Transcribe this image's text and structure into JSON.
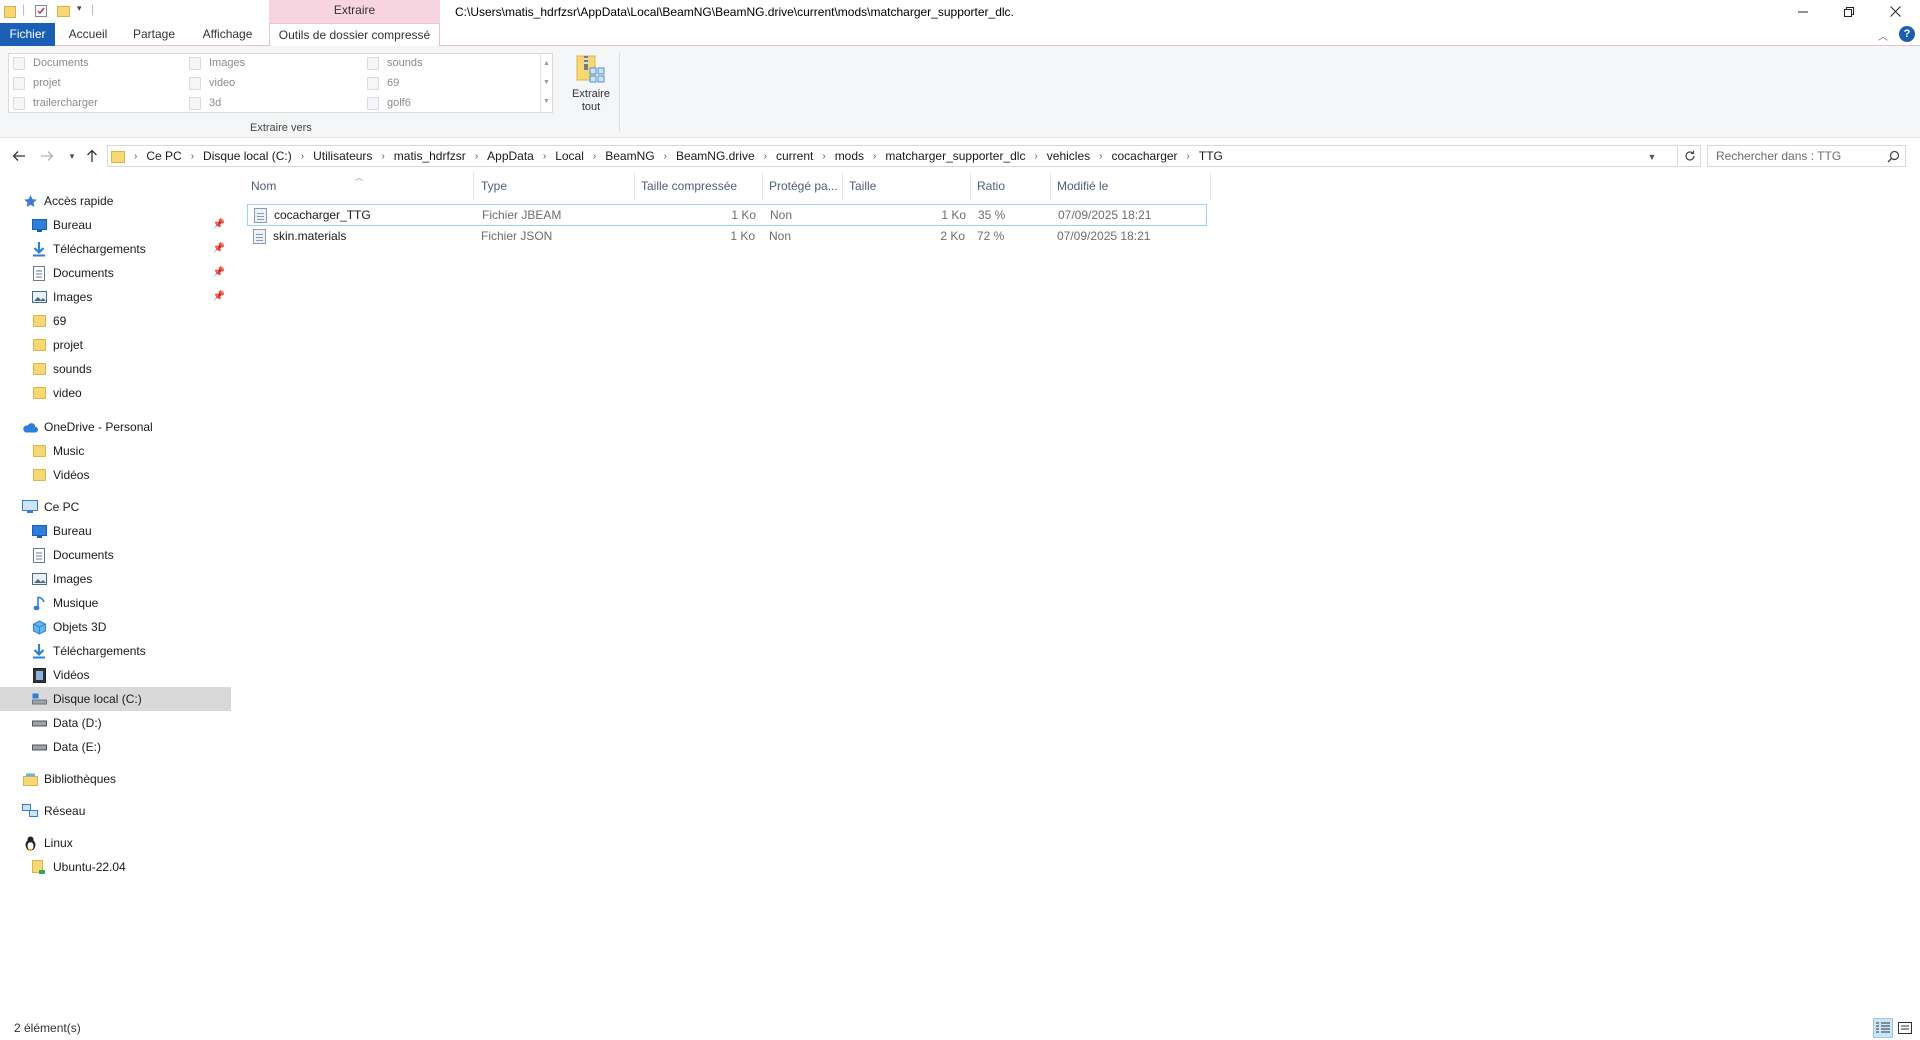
{
  "window": {
    "title": "C:\\Users\\matis_hdrfzsr\\AppData\\Local\\BeamNG\\BeamNG.drive\\current\\mods\\matcharger_supporter_dlc.",
    "context_header": "Extraire"
  },
  "ribbon": {
    "tabs": [
      "Fichier",
      "Accueil",
      "Partage",
      "Affichage",
      "Outils de dossier compressé"
    ],
    "gallery": {
      "col1": [
        "Documents",
        "projet",
        "trailercharger"
      ],
      "col2": [
        "Images",
        "video",
        "3d"
      ],
      "col3": [
        "sounds",
        "69",
        "golf6"
      ]
    },
    "group_label": "Extraire vers",
    "extract_all": {
      "line1": "Extraire",
      "line2": "tout"
    }
  },
  "address": {
    "breadcrumbs": [
      "Ce PC",
      "Disque local (C:)",
      "Utilisateurs",
      "matis_hdrfzsr",
      "AppData",
      "Local",
      "BeamNG",
      "BeamNG.drive",
      "current",
      "mods",
      "matcharger_supporter_dlc",
      "vehicles",
      "cocacharger",
      "TTG"
    ],
    "search_placeholder": "Rechercher dans : TTG"
  },
  "sidebar": {
    "quick_access": "Accès rapide",
    "quick_items": [
      {
        "label": "Bureau",
        "icon": "desktop-icon",
        "pinned": true
      },
      {
        "label": "Téléchargements",
        "icon": "downloads-icon",
        "pinned": true
      },
      {
        "label": "Documents",
        "icon": "documents-icon",
        "pinned": true
      },
      {
        "label": "Images",
        "icon": "pictures-icon",
        "pinned": true
      },
      {
        "label": "69",
        "icon": "folder-icon",
        "pinned": false
      },
      {
        "label": "projet",
        "icon": "folder-icon",
        "pinned": false
      },
      {
        "label": "sounds",
        "icon": "folder-icon",
        "pinned": false
      },
      {
        "label": "video",
        "icon": "folder-icon",
        "pinned": false
      }
    ],
    "onedrive": "OneDrive - Personal",
    "onedrive_items": [
      "Music",
      "Vidéos"
    ],
    "this_pc": "Ce PC",
    "pc_items": [
      {
        "label": "Bureau",
        "icon": "desktop-icon"
      },
      {
        "label": "Documents",
        "icon": "documents-icon"
      },
      {
        "label": "Images",
        "icon": "pictures-icon"
      },
      {
        "label": "Musique",
        "icon": "music-icon"
      },
      {
        "label": "Objets 3D",
        "icon": "3d-objects-icon"
      },
      {
        "label": "Téléchargements",
        "icon": "downloads-icon"
      },
      {
        "label": "Vidéos",
        "icon": "videos-icon"
      },
      {
        "label": "Disque local (C:)",
        "icon": "drive-c-icon",
        "selected": true
      },
      {
        "label": "Data (D:)",
        "icon": "drive-icon"
      },
      {
        "label": "Data (E:)",
        "icon": "drive-icon"
      }
    ],
    "libraries": "Bibliothèques",
    "network": "Réseau",
    "linux": "Linux",
    "linux_items": [
      "Ubuntu-22.04"
    ]
  },
  "files": {
    "columns": [
      "Nom",
      "Type",
      "Taille compressée",
      "Protégé pa...",
      "Taille",
      "Ratio",
      "Modifié le"
    ],
    "rows": [
      {
        "name": "cocacharger_TTG",
        "type": "Fichier JBEAM",
        "compressed": "1 Ko",
        "protected": "Non",
        "size": "1 Ko",
        "ratio": "35 %",
        "modified": "07/09/2025 18:21"
      },
      {
        "name": "skin.materials",
        "type": "Fichier JSON",
        "compressed": "1 Ko",
        "protected": "Non",
        "size": "2 Ko",
        "ratio": "72 %",
        "modified": "07/09/2025 18:21"
      }
    ]
  },
  "status": {
    "count": "2 élément(s)"
  },
  "colors": {
    "accent": "#1a5fb4",
    "context_tab": "#f7d4e0",
    "selection": "#d9d9d9",
    "focus_border": "#99d1ff"
  }
}
